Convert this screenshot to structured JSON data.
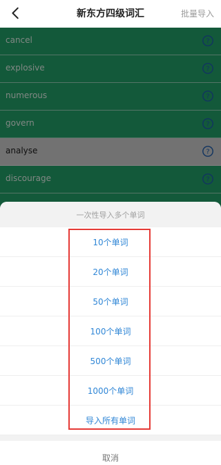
{
  "header": {
    "title": "新东方四级词汇",
    "batch_import": "批量导入"
  },
  "words": [
    {
      "text": "cancel",
      "state": "green"
    },
    {
      "text": "explosive",
      "state": "green"
    },
    {
      "text": "numerous",
      "state": "green"
    },
    {
      "text": "govern",
      "state": "green"
    },
    {
      "text": "analyse",
      "state": "gray"
    },
    {
      "text": "discourage",
      "state": "green"
    },
    {
      "text": "",
      "state": "green"
    },
    {
      "text": "",
      "state": "green"
    }
  ],
  "sheet": {
    "title": "一次性导入多个单词",
    "options": [
      "10个单词",
      "20个单词",
      "50个单词",
      "100个单词",
      "500个单词",
      "1000个单词",
      "导入所有单词"
    ],
    "cancel": "取消"
  },
  "colors": {
    "green": "#23a36a",
    "option_text": "#2f86d6",
    "highlight": "#e53935"
  }
}
